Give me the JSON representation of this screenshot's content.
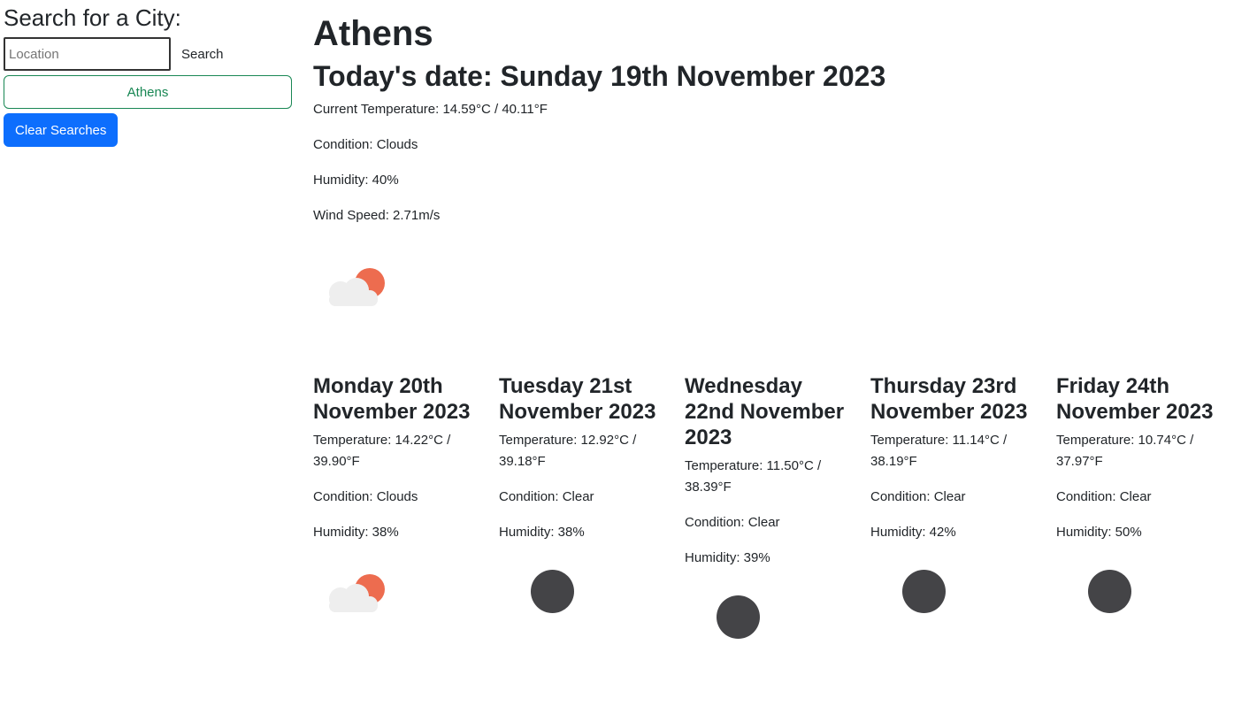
{
  "sidebar": {
    "heading": "Search for a City:",
    "search_placeholder": "Location",
    "search_value": "",
    "search_button": "Search",
    "history": [
      "Athens"
    ],
    "clear_button": "Clear Searches"
  },
  "current": {
    "city": "Athens",
    "date_heading": "Today's date: Sunday 19th November 2023",
    "temperature": "Current Temperature: 14.59°C / 40.11°F",
    "condition": "Condition: Clouds",
    "humidity": "Humidity: 40%",
    "wind": "Wind Speed: 2.71m/s",
    "icon": "cloud-sun-icon"
  },
  "forecast": [
    {
      "date": "Monday 20th November 2023",
      "temperature": "Temperature: 14.22°C / 39.90°F",
      "condition": "Condition: Clouds",
      "humidity": "Humidity: 38%",
      "icon": "cloud-sun-icon"
    },
    {
      "date": "Tuesday 21st November 2023",
      "temperature": "Temperature: 12.92°C / 39.18°F",
      "condition": "Condition: Clear",
      "humidity": "Humidity: 38%",
      "icon": "moon-icon"
    },
    {
      "date": "Wednesday 22nd November 2023",
      "temperature": "Temperature: 11.50°C / 38.39°F",
      "condition": "Condition: Clear",
      "humidity": "Humidity: 39%",
      "icon": "moon-icon"
    },
    {
      "date": "Thursday 23rd November 2023",
      "temperature": "Temperature: 11.14°C / 38.19°F",
      "condition": "Condition: Clear",
      "humidity": "Humidity: 42%",
      "icon": "moon-icon"
    },
    {
      "date": "Friday 24th November 2023",
      "temperature": "Temperature: 10.74°C / 37.97°F",
      "condition": "Condition: Clear",
      "humidity": "Humidity: 50%",
      "icon": "moon-icon"
    }
  ],
  "colors": {
    "history_button": "#198754",
    "clear_button": "#0d6efd",
    "sun": "#ed6c4f",
    "cloud": "#eeeeee",
    "moon": "#444447"
  }
}
